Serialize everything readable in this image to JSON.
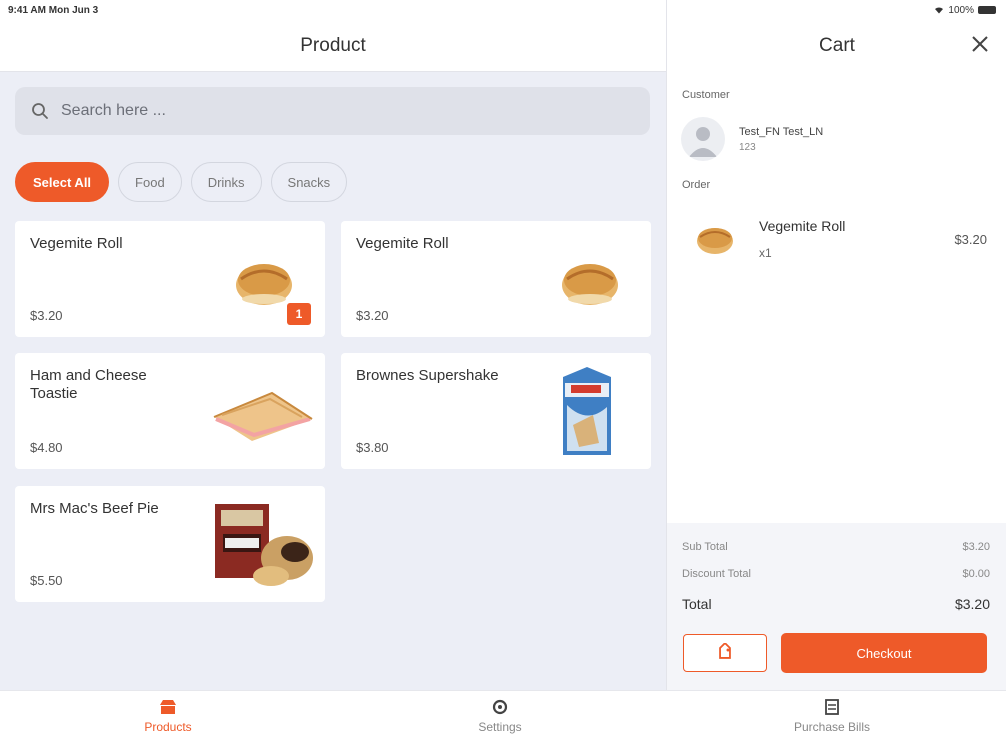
{
  "status": {
    "carrier": "9:41 AM  Mon Jun 3",
    "battery": "100%"
  },
  "products_pane": {
    "title": "Product",
    "search": {
      "placeholder": "Search here ..."
    },
    "filters": [
      {
        "label": "Select All",
        "active": true
      },
      {
        "label": "Food",
        "active": false
      },
      {
        "label": "Drinks",
        "active": false
      },
      {
        "label": "Snacks",
        "active": false
      }
    ],
    "products": [
      {
        "name": "Vegemite Roll",
        "price": "$3.20",
        "qty": "1",
        "image": "pastry-roll"
      },
      {
        "name": "Vegemite Roll",
        "price": "$3.20",
        "qty": "",
        "image": "pastry-roll"
      },
      {
        "name": "Ham and Cheese Toastie",
        "price": "$4.80",
        "qty": "",
        "image": "toastie"
      },
      {
        "name": "Brownes Supershake",
        "price": "$3.80",
        "qty": "",
        "image": "milk-carton"
      },
      {
        "name": "Mrs Mac's Beef Pie",
        "price": "$5.50",
        "qty": "",
        "image": "meat-pie"
      }
    ]
  },
  "cart": {
    "title": "Cart",
    "customer_label": "Customer",
    "customer": {
      "name": "Test_FN Test_LN",
      "id": "123"
    },
    "order_label": "Order",
    "items": [
      {
        "name": "Vegemite Roll",
        "qty": "x1",
        "price": "$3.20"
      }
    ],
    "summary": {
      "subtotal_label": "Sub Total",
      "subtotal": "$3.20",
      "discount_label": "Discount Total",
      "discount": "$0.00",
      "total_label": "Total",
      "total": "$3.20"
    },
    "checkout_label": "Checkout"
  },
  "tabs": [
    {
      "label": "Products",
      "icon": "shop-icon",
      "active": true
    },
    {
      "label": "Settings",
      "icon": "settings-icon",
      "active": false
    },
    {
      "label": "Purchase Bills",
      "icon": "bill-icon",
      "active": false
    }
  ],
  "colors": {
    "accent": "#ee5a29",
    "pane_bg": "#eceef6"
  }
}
